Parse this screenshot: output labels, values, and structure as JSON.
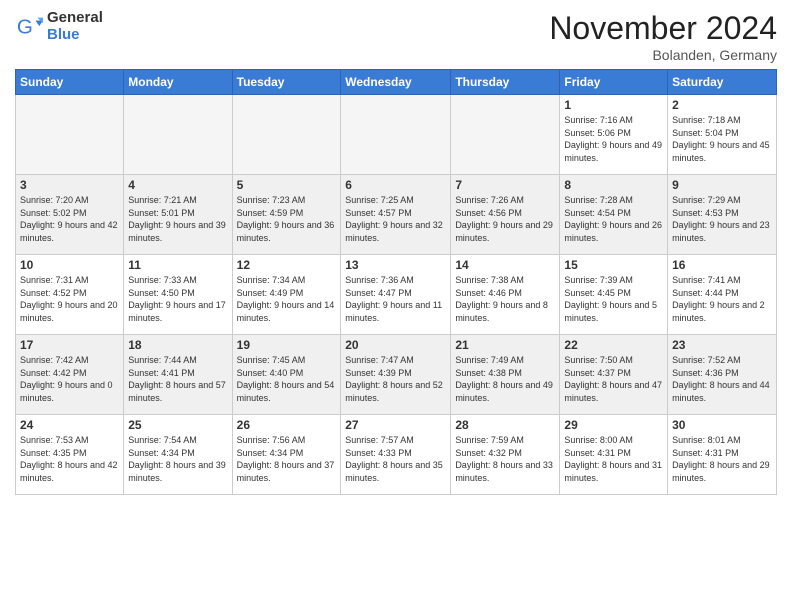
{
  "logo": {
    "general": "General",
    "blue": "Blue"
  },
  "title": "November 2024",
  "location": "Bolanden, Germany",
  "days_of_week": [
    "Sunday",
    "Monday",
    "Tuesday",
    "Wednesday",
    "Thursday",
    "Friday",
    "Saturday"
  ],
  "weeks": [
    [
      {
        "day": "",
        "info": ""
      },
      {
        "day": "",
        "info": ""
      },
      {
        "day": "",
        "info": ""
      },
      {
        "day": "",
        "info": ""
      },
      {
        "day": "",
        "info": ""
      },
      {
        "day": "1",
        "info": "Sunrise: 7:16 AM\nSunset: 5:06 PM\nDaylight: 9 hours and 49 minutes."
      },
      {
        "day": "2",
        "info": "Sunrise: 7:18 AM\nSunset: 5:04 PM\nDaylight: 9 hours and 45 minutes."
      }
    ],
    [
      {
        "day": "3",
        "info": "Sunrise: 7:20 AM\nSunset: 5:02 PM\nDaylight: 9 hours and 42 minutes."
      },
      {
        "day": "4",
        "info": "Sunrise: 7:21 AM\nSunset: 5:01 PM\nDaylight: 9 hours and 39 minutes."
      },
      {
        "day": "5",
        "info": "Sunrise: 7:23 AM\nSunset: 4:59 PM\nDaylight: 9 hours and 36 minutes."
      },
      {
        "day": "6",
        "info": "Sunrise: 7:25 AM\nSunset: 4:57 PM\nDaylight: 9 hours and 32 minutes."
      },
      {
        "day": "7",
        "info": "Sunrise: 7:26 AM\nSunset: 4:56 PM\nDaylight: 9 hours and 29 minutes."
      },
      {
        "day": "8",
        "info": "Sunrise: 7:28 AM\nSunset: 4:54 PM\nDaylight: 9 hours and 26 minutes."
      },
      {
        "day": "9",
        "info": "Sunrise: 7:29 AM\nSunset: 4:53 PM\nDaylight: 9 hours and 23 minutes."
      }
    ],
    [
      {
        "day": "10",
        "info": "Sunrise: 7:31 AM\nSunset: 4:52 PM\nDaylight: 9 hours and 20 minutes."
      },
      {
        "day": "11",
        "info": "Sunrise: 7:33 AM\nSunset: 4:50 PM\nDaylight: 9 hours and 17 minutes."
      },
      {
        "day": "12",
        "info": "Sunrise: 7:34 AM\nSunset: 4:49 PM\nDaylight: 9 hours and 14 minutes."
      },
      {
        "day": "13",
        "info": "Sunrise: 7:36 AM\nSunset: 4:47 PM\nDaylight: 9 hours and 11 minutes."
      },
      {
        "day": "14",
        "info": "Sunrise: 7:38 AM\nSunset: 4:46 PM\nDaylight: 9 hours and 8 minutes."
      },
      {
        "day": "15",
        "info": "Sunrise: 7:39 AM\nSunset: 4:45 PM\nDaylight: 9 hours and 5 minutes."
      },
      {
        "day": "16",
        "info": "Sunrise: 7:41 AM\nSunset: 4:44 PM\nDaylight: 9 hours and 2 minutes."
      }
    ],
    [
      {
        "day": "17",
        "info": "Sunrise: 7:42 AM\nSunset: 4:42 PM\nDaylight: 9 hours and 0 minutes."
      },
      {
        "day": "18",
        "info": "Sunrise: 7:44 AM\nSunset: 4:41 PM\nDaylight: 8 hours and 57 minutes."
      },
      {
        "day": "19",
        "info": "Sunrise: 7:45 AM\nSunset: 4:40 PM\nDaylight: 8 hours and 54 minutes."
      },
      {
        "day": "20",
        "info": "Sunrise: 7:47 AM\nSunset: 4:39 PM\nDaylight: 8 hours and 52 minutes."
      },
      {
        "day": "21",
        "info": "Sunrise: 7:49 AM\nSunset: 4:38 PM\nDaylight: 8 hours and 49 minutes."
      },
      {
        "day": "22",
        "info": "Sunrise: 7:50 AM\nSunset: 4:37 PM\nDaylight: 8 hours and 47 minutes."
      },
      {
        "day": "23",
        "info": "Sunrise: 7:52 AM\nSunset: 4:36 PM\nDaylight: 8 hours and 44 minutes."
      }
    ],
    [
      {
        "day": "24",
        "info": "Sunrise: 7:53 AM\nSunset: 4:35 PM\nDaylight: 8 hours and 42 minutes."
      },
      {
        "day": "25",
        "info": "Sunrise: 7:54 AM\nSunset: 4:34 PM\nDaylight: 8 hours and 39 minutes."
      },
      {
        "day": "26",
        "info": "Sunrise: 7:56 AM\nSunset: 4:34 PM\nDaylight: 8 hours and 37 minutes."
      },
      {
        "day": "27",
        "info": "Sunrise: 7:57 AM\nSunset: 4:33 PM\nDaylight: 8 hours and 35 minutes."
      },
      {
        "day": "28",
        "info": "Sunrise: 7:59 AM\nSunset: 4:32 PM\nDaylight: 8 hours and 33 minutes."
      },
      {
        "day": "29",
        "info": "Sunrise: 8:00 AM\nSunset: 4:31 PM\nDaylight: 8 hours and 31 minutes."
      },
      {
        "day": "30",
        "info": "Sunrise: 8:01 AM\nSunset: 4:31 PM\nDaylight: 8 hours and 29 minutes."
      }
    ]
  ]
}
